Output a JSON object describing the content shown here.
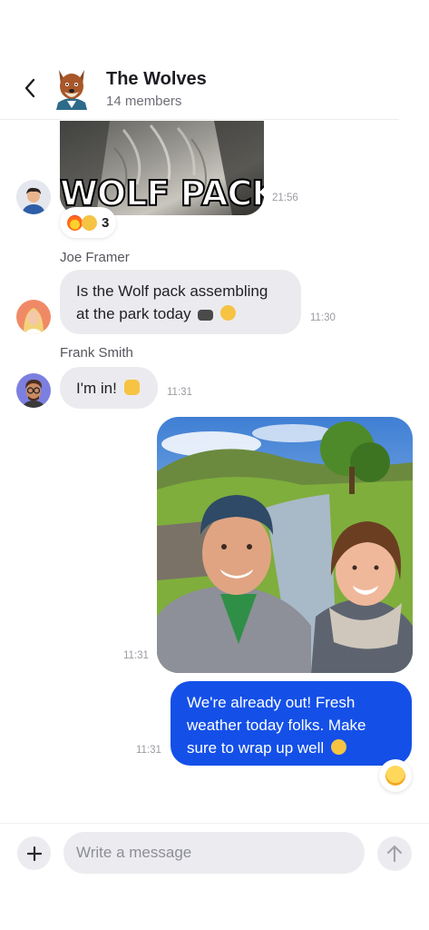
{
  "header": {
    "title": "The Wolves",
    "members": "14 members"
  },
  "messages": {
    "wolf_image": {
      "caption": "WOLF PACK",
      "time": "21:56",
      "reaction_count": "3"
    },
    "joe": {
      "sender": "Joe Framer",
      "text": "Is the Wolf pack assembling at the park today",
      "time": "11:30"
    },
    "frank": {
      "sender": "Frank Smith",
      "text": "I'm in!",
      "time": "11:31"
    },
    "selfie": {
      "time": "11:31"
    },
    "mine": {
      "text": "We're already out! Fresh weather today folks. Make sure to wrap up well",
      "time": "11:31"
    }
  },
  "composer": {
    "placeholder": "Write a message"
  },
  "colors": {
    "outgoing_bubble": "#1450e8",
    "incoming_bubble": "#ebebef"
  },
  "icons": {
    "back": "chevron-left-icon",
    "add": "plus-icon",
    "send": "arrow-up-icon"
  }
}
